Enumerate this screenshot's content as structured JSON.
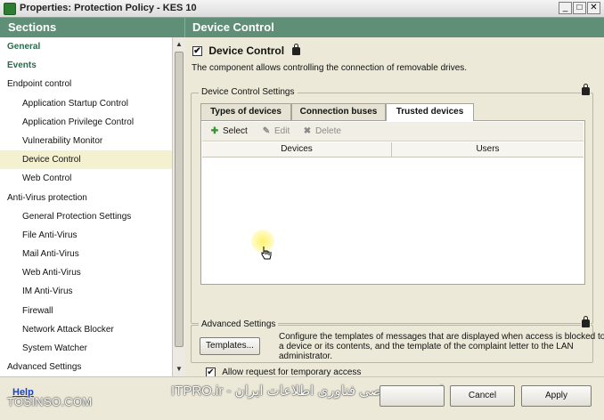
{
  "window": {
    "title": "Properties: Protection Policy - KES 10",
    "controls": [
      "_",
      "□",
      "✕"
    ]
  },
  "sidebar": {
    "header": "Sections",
    "items": [
      {
        "label": "General",
        "style": "bold"
      },
      {
        "label": "Events",
        "style": "bold"
      },
      {
        "label": "Endpoint control",
        "style": "normal"
      },
      {
        "label": "Application Startup Control",
        "style": "sub"
      },
      {
        "label": "Application Privilege Control",
        "style": "sub"
      },
      {
        "label": "Vulnerability Monitor",
        "style": "sub"
      },
      {
        "label": "Device Control",
        "style": "sub",
        "selected": true
      },
      {
        "label": "Web Control",
        "style": "sub"
      },
      {
        "label": "Anti-Virus protection",
        "style": "normal"
      },
      {
        "label": "General Protection Settings",
        "style": "sub"
      },
      {
        "label": "File Anti-Virus",
        "style": "sub"
      },
      {
        "label": "Mail Anti-Virus",
        "style": "sub"
      },
      {
        "label": "Web Anti-Virus",
        "style": "sub"
      },
      {
        "label": "IM Anti-Virus",
        "style": "sub"
      },
      {
        "label": "Firewall",
        "style": "sub"
      },
      {
        "label": "Network Attack Blocker",
        "style": "sub"
      },
      {
        "label": "System Watcher",
        "style": "sub"
      },
      {
        "label": "Advanced Settings",
        "style": "normal"
      }
    ]
  },
  "main": {
    "header": "Device Control",
    "enable_label": "Device Control",
    "enable_checked": true,
    "description": "The component allows controlling the connection of removable drives.",
    "settings_group": {
      "label": "Device Control Settings",
      "tabs": [
        "Types of devices",
        "Connection buses",
        "Trusted devices"
      ],
      "active_tab": 2,
      "toolbar": {
        "select": "Select",
        "edit": "Edit",
        "delete": "Delete"
      },
      "columns": [
        "Devices",
        "Users"
      ],
      "temp_access_label": "Allow request for temporary access",
      "temp_access_checked": true
    },
    "advanced_group": {
      "label": "Advanced Settings",
      "templates_button": "Templates...",
      "description": "Configure the templates of messages that are displayed when access is blocked to a device or its contents, and the template of the complaint letter to the LAN administrator."
    }
  },
  "footer": {
    "help": "Help",
    "watermark_left": "TOSINSO.COM",
    "watermark_mid": "ITPRO.ir - انجمن تخصصی فناوری اطلاعات ایران",
    "cancel": "Cancel",
    "apply": "Apply"
  },
  "colors": {
    "header_green": "#5f8f77",
    "selected_row": "#f4f1d0",
    "link_blue": "#1a3fbf"
  }
}
